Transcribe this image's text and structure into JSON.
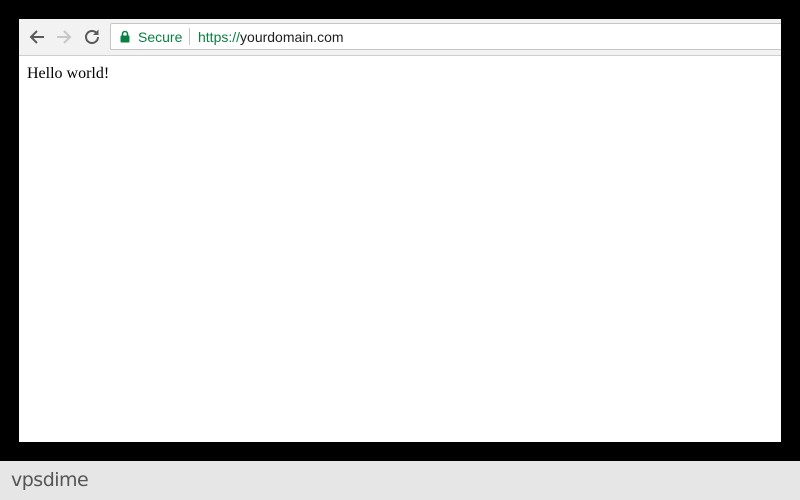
{
  "browser": {
    "security_label": "Secure",
    "url_scheme": "https://",
    "url_host": "yourdomain.com",
    "colors": {
      "secure": "#0b8043",
      "url_text": "#202020"
    },
    "icons": {
      "back": "arrow-back-icon",
      "forward": "arrow-forward-icon",
      "reload": "reload-icon",
      "lock": "lock-icon"
    }
  },
  "page": {
    "body_text": "Hello world!"
  },
  "footer": {
    "brand": "vpsdime"
  }
}
